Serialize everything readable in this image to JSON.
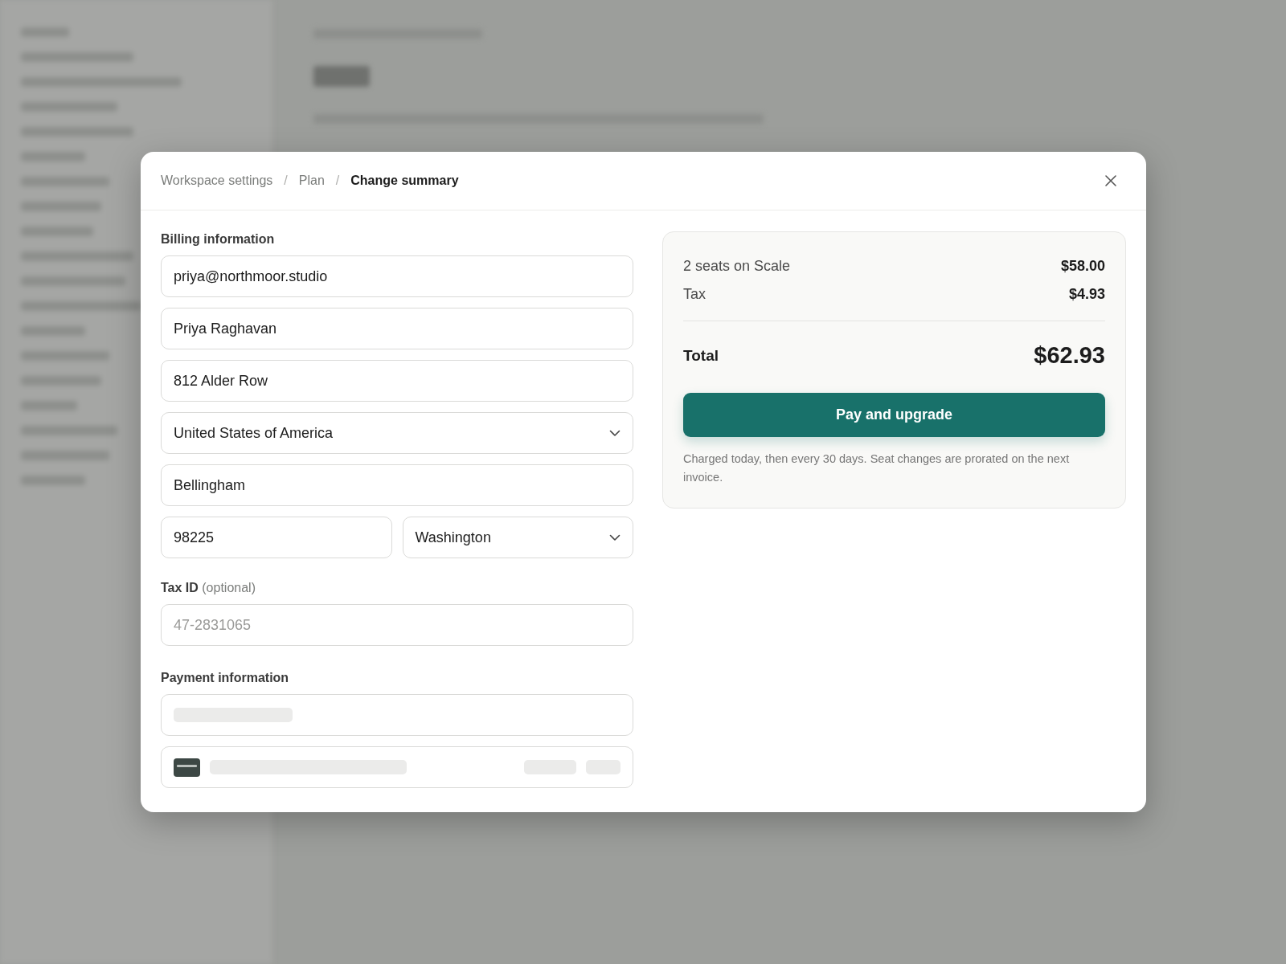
{
  "breadcrumb": [
    {
      "label": "Workspace settings",
      "current": false
    },
    {
      "separator": "/",
      "label": "Plan",
      "current": false
    },
    {
      "separator": "/",
      "label": "Change summary",
      "current": true
    }
  ],
  "billing": {
    "title": "Billing information",
    "rows": [
      [
        {
          "kind": "text",
          "value": "priya@northmoor.studio"
        }
      ],
      [
        {
          "kind": "text",
          "value": "Priya Raghavan"
        }
      ],
      [
        {
          "kind": "text",
          "value": "812 Alder Row"
        }
      ],
      [
        {
          "kind": "select",
          "value": "United States of America"
        }
      ],
      [
        {
          "kind": "text",
          "value": "Bellingham"
        }
      ],
      [
        {
          "kind": "text",
          "value": "98225"
        },
        {
          "kind": "select",
          "value": "Washington"
        }
      ]
    ]
  },
  "tax_id": {
    "label": "Tax ID",
    "hint": "(optional)",
    "placeholder": "47-2831065"
  },
  "payment": {
    "title": "Payment information",
    "rows": [
      {
        "kind": "skeleton-line"
      },
      {
        "kind": "skeleton-card"
      }
    ]
  },
  "summary": {
    "lines": [
      {
        "label": "2 seats on Scale",
        "amount": "$58.00"
      },
      {
        "label": "Tax",
        "amount": "$4.93"
      }
    ],
    "total": {
      "label": "Total",
      "amount": "$62.93"
    },
    "button": "Pay and upgrade",
    "note": "Charged today, then every 30 days. Seat changes are prorated on the next invoice."
  }
}
